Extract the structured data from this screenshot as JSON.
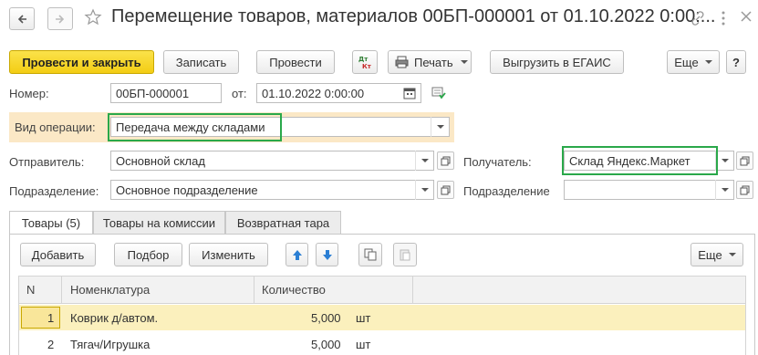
{
  "window": {
    "title": "Перемещение товаров, материалов 00БП-000001 от 01.10.2022 0:00:..."
  },
  "toolbar": {
    "post_close_label": "Провести и закрыть",
    "save_label": "Записать",
    "post_label": "Провести",
    "print_label": "Печать",
    "egais_label": "Выгрузить в ЕГАИС",
    "more_label": "Еще"
  },
  "header": {
    "number_label": "Номер:",
    "number_value": "00БП-000001",
    "date_label": "от:",
    "date_value": "01.10.2022  0:00:00",
    "operation_label": "Вид операции:",
    "operation_value": "Передача между складами",
    "sender_label": "Отправитель:",
    "sender_value": "Основной склад",
    "recipient_label": "Получатель:",
    "recipient_value": "Склад Яндекс.Маркет",
    "division_label": "Подразделение:",
    "division_value": "Основное подразделение",
    "division2_label": "Подразделение",
    "division2_value": ""
  },
  "tabs": [
    {
      "label": "Товары (5)"
    },
    {
      "label": "Товары на комиссии"
    },
    {
      "label": "Возвратная тара"
    }
  ],
  "table_toolbar": {
    "add_label": "Добавить",
    "pick_label": "Подбор",
    "edit_label": "Изменить",
    "more_label": "Еще"
  },
  "table": {
    "columns": [
      "N",
      "Номенклатура",
      "Количество"
    ],
    "rows": [
      {
        "n": "1",
        "name": "Коврик д/автом.",
        "qty": "5,000",
        "unit": "шт"
      },
      {
        "n": "2",
        "name": "Тягач/Игрушка",
        "qty": "5,000",
        "unit": "шт"
      }
    ]
  },
  "colors": {
    "primary_button": "#f5d21c",
    "highlight_row": "#fbf0bd",
    "green_outline": "#2aa84a",
    "operation_band": "#fbe8c6"
  }
}
